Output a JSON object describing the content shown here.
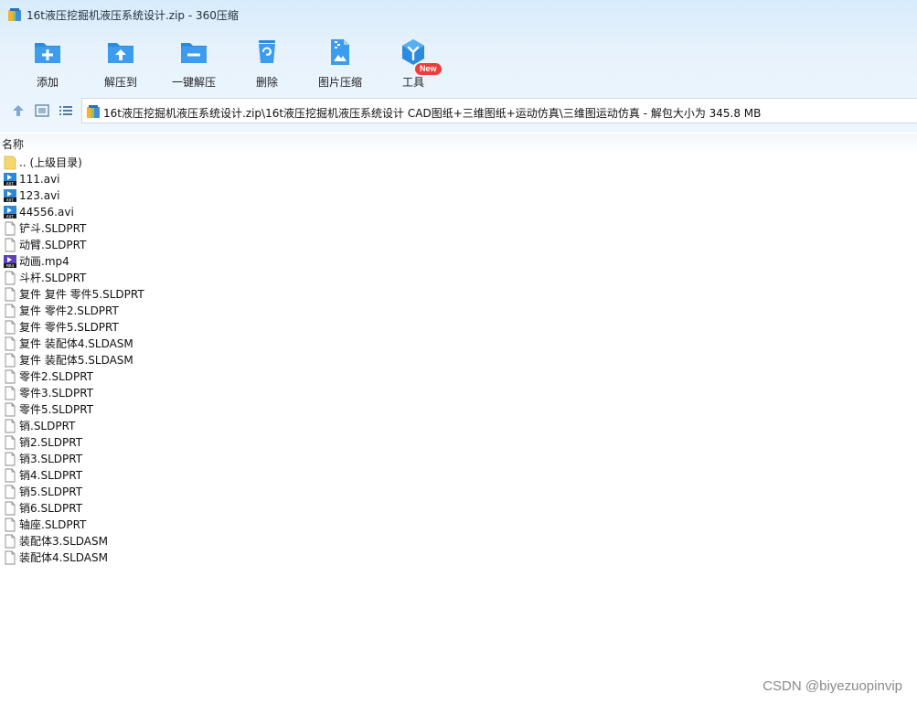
{
  "window": {
    "title": "16t液压挖掘机液压系统设计.zip - 360压缩"
  },
  "toolbar": {
    "add_label": "添加",
    "extract_to_label": "解压到",
    "one_click_extract_label": "一键解压",
    "delete_label": "删除",
    "image_compress_label": "图片压缩",
    "tools_label": "工具",
    "tools_badge": "New"
  },
  "address": {
    "path": "16t液压挖掘机液压系统设计.zip\\16t液压挖掘机液压系统设计 CAD图纸+三维图纸+运动仿真\\三维图运动仿真 - 解包大小为 345.8 MB"
  },
  "list": {
    "column_name": "名称",
    "parent_label": ".. (上级目录)",
    "files": [
      {
        "name": "111.avi",
        "type": "avi"
      },
      {
        "name": "123.avi",
        "type": "avi"
      },
      {
        "name": "44556.avi",
        "type": "avi"
      },
      {
        "name": "铲斗.SLDPRT",
        "type": "doc"
      },
      {
        "name": "动臂.SLDPRT",
        "type": "doc"
      },
      {
        "name": "动画.mp4",
        "type": "mp4"
      },
      {
        "name": "斗杆.SLDPRT",
        "type": "doc"
      },
      {
        "name": "复件 复件 零件5.SLDPRT",
        "type": "doc"
      },
      {
        "name": "复件 零件2.SLDPRT",
        "type": "doc"
      },
      {
        "name": "复件 零件5.SLDPRT",
        "type": "doc"
      },
      {
        "name": "复件 装配体4.SLDASM",
        "type": "doc"
      },
      {
        "name": "复件 装配体5.SLDASM",
        "type": "doc"
      },
      {
        "name": "零件2.SLDPRT",
        "type": "doc"
      },
      {
        "name": "零件3.SLDPRT",
        "type": "doc"
      },
      {
        "name": "零件5.SLDPRT",
        "type": "doc"
      },
      {
        "name": "销.SLDPRT",
        "type": "doc"
      },
      {
        "name": "销2.SLDPRT",
        "type": "doc"
      },
      {
        "name": "销3.SLDPRT",
        "type": "doc"
      },
      {
        "name": "销4.SLDPRT",
        "type": "doc"
      },
      {
        "name": "销5.SLDPRT",
        "type": "doc"
      },
      {
        "name": "销6.SLDPRT",
        "type": "doc"
      },
      {
        "name": "轴座.SLDPRT",
        "type": "doc"
      },
      {
        "name": "装配体3.SLDASM",
        "type": "doc"
      },
      {
        "name": "装配体4.SLDASM",
        "type": "doc"
      }
    ]
  },
  "watermark": "CSDN @biyezuopinvip",
  "colors": {
    "accent_blue": "#2a8be0",
    "badge_red": "#f23c3c",
    "mp4_purple": "#5b3fbf"
  }
}
